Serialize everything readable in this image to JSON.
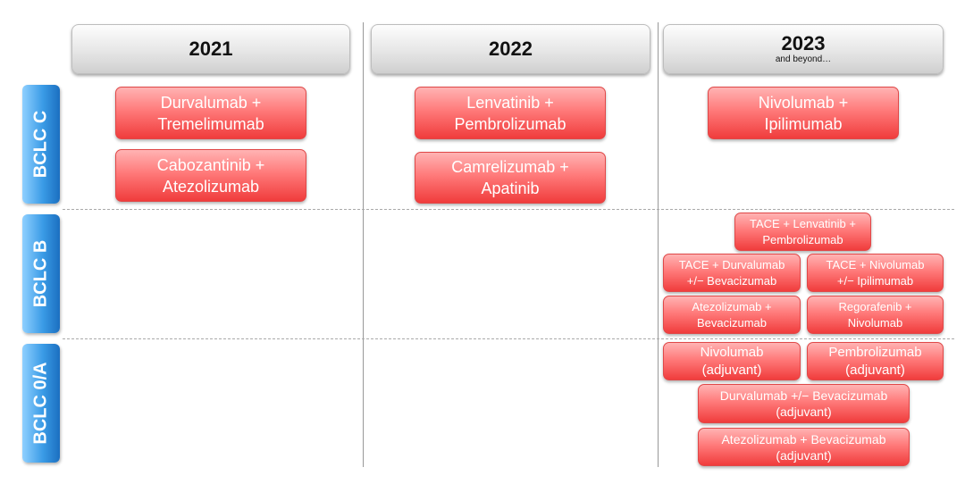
{
  "columns": [
    {
      "year": "2021",
      "subtitle": ""
    },
    {
      "year": "2022",
      "subtitle": ""
    },
    {
      "year": "2023",
      "subtitle": "and beyond…"
    }
  ],
  "rows": [
    "BCLC C",
    "BCLC B",
    "BCLC 0/A"
  ],
  "colors": {
    "drug_box": "#f05050",
    "row_label": "#2f8fe0",
    "header": "#e0e0e0"
  },
  "therapies": {
    "c2021": [
      "Durvalumab +\nTremelimumab",
      "Cabozantinib +\nAtezolizumab"
    ],
    "c2022": [
      "Lenvatinib +\nPembrolizumab",
      "Camrelizumab +\nApatinib"
    ],
    "c2023": [
      "Nivolumab +\nIpilimumab"
    ],
    "b2023": [
      "TACE + Lenvatinib +\nPembrolizumab",
      "TACE + Durvalumab\n+/− Bevacizumab",
      "TACE + Nivolumab\n+/− Ipilimumab",
      "Atezolizumab +\nBevacizumab",
      "Regorafenib +\nNivolumab"
    ],
    "a2023": [
      "Nivolumab\n(adjuvant)",
      "Pembrolizumab\n(adjuvant)",
      "Durvalumab +/− Bevacizumab\n(adjuvant)",
      "Atezolizumab + Bevacizumab\n(adjuvant)"
    ]
  }
}
